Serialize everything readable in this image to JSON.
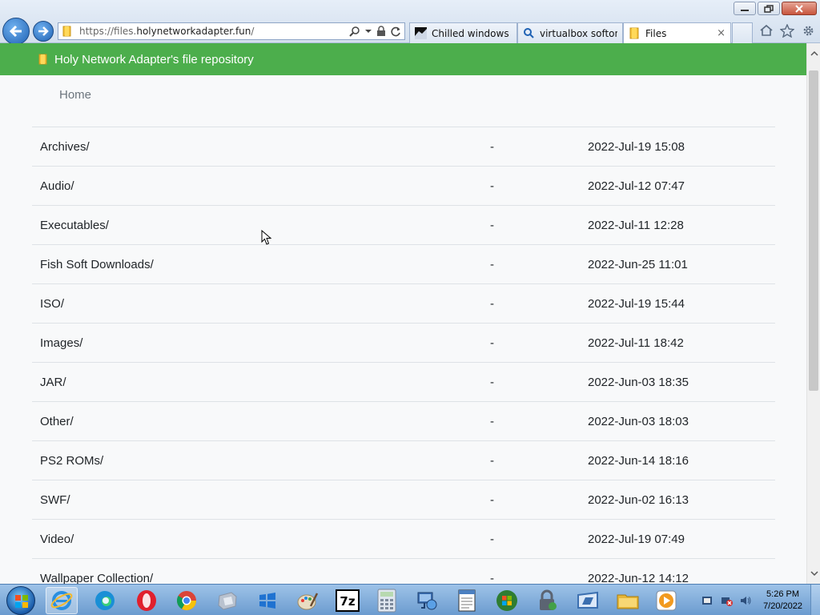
{
  "browser": {
    "url_prefix": "https://files.",
    "url_host": "holynetworkadapter.fun",
    "url_path": "/",
    "tabs": [
      {
        "label": "Chilled windows ...",
        "icon": "video-thumbnail-icon",
        "active": false
      },
      {
        "label": "virtualbox softoni...",
        "icon": "search-icon",
        "active": false
      },
      {
        "label": "Files",
        "icon": "folder-icon",
        "active": true
      }
    ],
    "close_tab_glyph": "×"
  },
  "page": {
    "banner_title": "Holy Network Adapter's file repository",
    "breadcrumb": "Home",
    "entries": [
      {
        "name": "Archives/",
        "size": "-",
        "date": "2022-Jul-19 15:08"
      },
      {
        "name": "Audio/",
        "size": "-",
        "date": "2022-Jul-12 07:47"
      },
      {
        "name": "Executables/",
        "size": "-",
        "date": "2022-Jul-11 12:28"
      },
      {
        "name": "Fish Soft Downloads/",
        "size": "-",
        "date": "2022-Jun-25 11:01"
      },
      {
        "name": "ISO/",
        "size": "-",
        "date": "2022-Jul-19 15:44"
      },
      {
        "name": "Images/",
        "size": "-",
        "date": "2022-Jul-11 18:42"
      },
      {
        "name": "JAR/",
        "size": "-",
        "date": "2022-Jun-03 18:35"
      },
      {
        "name": "Other/",
        "size": "-",
        "date": "2022-Jun-03 18:03"
      },
      {
        "name": "PS2 ROMs/",
        "size": "-",
        "date": "2022-Jun-14 18:16"
      },
      {
        "name": "SWF/",
        "size": "-",
        "date": "2022-Jun-02 16:13"
      },
      {
        "name": "Video/",
        "size": "-",
        "date": "2022-Jul-19 07:49"
      },
      {
        "name": "Wallpaper Collection/",
        "size": "-",
        "date": "2022-Jun-12 14:12"
      }
    ]
  },
  "taskbar": {
    "time": "5:26 PM",
    "date": "7/20/2022",
    "items": [
      "internet-explorer-icon",
      "edge-icon",
      "opera-icon",
      "chrome-icon",
      "virtualbox-icon",
      "windows-store-icon",
      "paint-icon",
      "7zip-icon",
      "calculator-icon",
      "network-icon",
      "notepad-icon",
      "windows-logo-icon",
      "lock-icon",
      "image-editor-icon",
      "file-explorer-icon",
      "media-player-icon"
    ],
    "sevenzip_label": "7z"
  },
  "colors": {
    "banner": "#4cae4c",
    "page_bg": "#f8f9fa",
    "row_border": "#dee2e6",
    "breadcrumb": "#6c757d"
  }
}
